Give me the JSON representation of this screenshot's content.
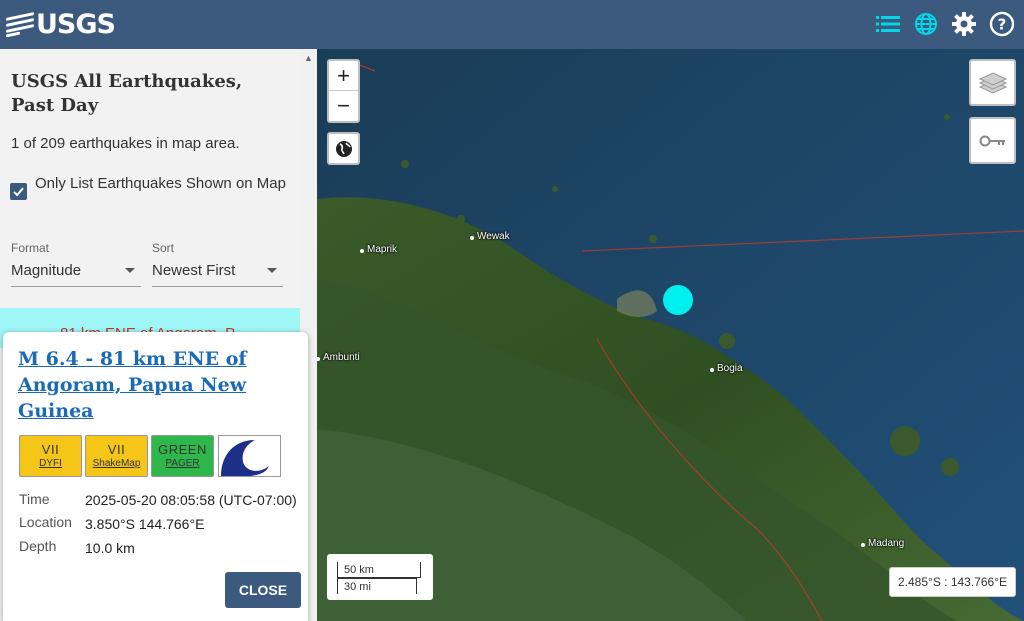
{
  "header": {
    "logo_text": "USGS",
    "icons": [
      "list-icon",
      "globe-icon",
      "gear-icon",
      "help-icon"
    ],
    "bg_color": "#3b5a7d",
    "active_icon_color": "#00d8e8"
  },
  "sidebar": {
    "title": "USGS All Earthquakes, Past Day",
    "count_text": "1 of 209 earthquakes in map area.",
    "only_list_label": "Only List Earthquakes Shown on Map",
    "only_list_checked": true,
    "format_label": "Format",
    "format_value": "Magnitude",
    "sort_label": "Sort",
    "sort_value": "Newest First",
    "list_item_text": "81 km ENE of Angoram, P"
  },
  "popup": {
    "title": "M 6.4 - 81 km ENE of Angoram, Papua New Guinea",
    "badges": [
      {
        "value": "VII",
        "label": "DYFI",
        "color": "#f5c518"
      },
      {
        "value": "VII",
        "label": "ShakeMap",
        "color": "#f5c518"
      },
      {
        "value": "GREEN",
        "label": "PAGER",
        "color": "#2eb84b"
      }
    ],
    "time_label": "Time",
    "time_value": "2025-05-20 08:05:58 (UTC-07:00)",
    "location_label": "Location",
    "location_value": "3.850°S 144.766°E",
    "depth_label": "Depth",
    "depth_value": "10.0 km",
    "close_label": "CLOSE"
  },
  "map": {
    "zoom_in": "+",
    "zoom_out": "−",
    "places": [
      "Wewak",
      "Maprik",
      "Ambunti",
      "Bogia",
      "Madang"
    ],
    "scale_km": "50 km",
    "scale_mi": "30 mi",
    "coords": "2.485°S : 143.766°E",
    "quake_color": "#00f0f0"
  }
}
